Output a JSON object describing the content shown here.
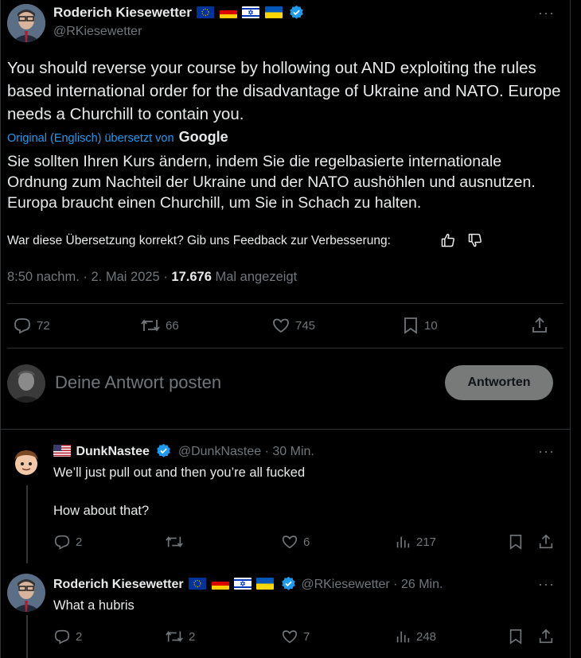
{
  "main_tweet": {
    "author_name": "Roderich Kiesewetter",
    "handle": "@RKiesewetter",
    "text": "You should reverse your course by hollowing out AND exploiting the rules based international order for the disadvantage of Ukraine and NATO. Europe needs a Churchill to contain you.",
    "translation_label": "Original (Englisch) übersetzt von",
    "translation_provider": "Google",
    "translated_text": "Sie sollten Ihren Kurs ändern, indem Sie die regelbasierte internationale Ordnung zum Nachteil der Ukraine und der NATO aushöhlen und ausnutzen. Europa braucht einen Churchill, um Sie in Schach zu halten.",
    "feedback_prompt": "War diese Übersetzung korrekt? Gib uns Feedback zur Verbesserung:",
    "time": "8:50 nachm.",
    "date": "2. Mai 2025",
    "views_count": "17.676",
    "views_label": "Mal angezeigt",
    "replies": "72",
    "reposts": "66",
    "likes": "745",
    "bookmarks": "10"
  },
  "reply_box": {
    "placeholder": "Deine Antwort posten",
    "button": "Antworten"
  },
  "replies": [
    {
      "author_name": "DunkNastee",
      "handle": "@DunkNastee",
      "time": "30 Min.",
      "lines": [
        "We’ll just pull out and then you’re all fucked",
        "How about that?"
      ],
      "replies": "2",
      "reposts": "",
      "likes": "6",
      "views": "217"
    },
    {
      "author_name": "Roderich Kiesewetter",
      "handle": "@RKiesewetter",
      "time": "26 Min.",
      "lines": [
        "What a hubris"
      ],
      "replies": "2",
      "reposts": "2",
      "likes": "7",
      "views": "248"
    }
  ],
  "colors": {
    "background": "#000000",
    "text": "#e7e9ea",
    "muted": "#71767b",
    "link": "#1d9bf0",
    "border": "#2f3336"
  },
  "icons": [
    "verified-badge-icon",
    "eu-flag-icon",
    "germany-flag-icon",
    "israel-flag-icon",
    "ukraine-flag-icon",
    "more-icon",
    "reply-icon",
    "repost-icon",
    "like-icon",
    "bookmark-icon",
    "share-icon",
    "views-icon",
    "thumbs-up-icon",
    "thumbs-down-icon"
  ]
}
